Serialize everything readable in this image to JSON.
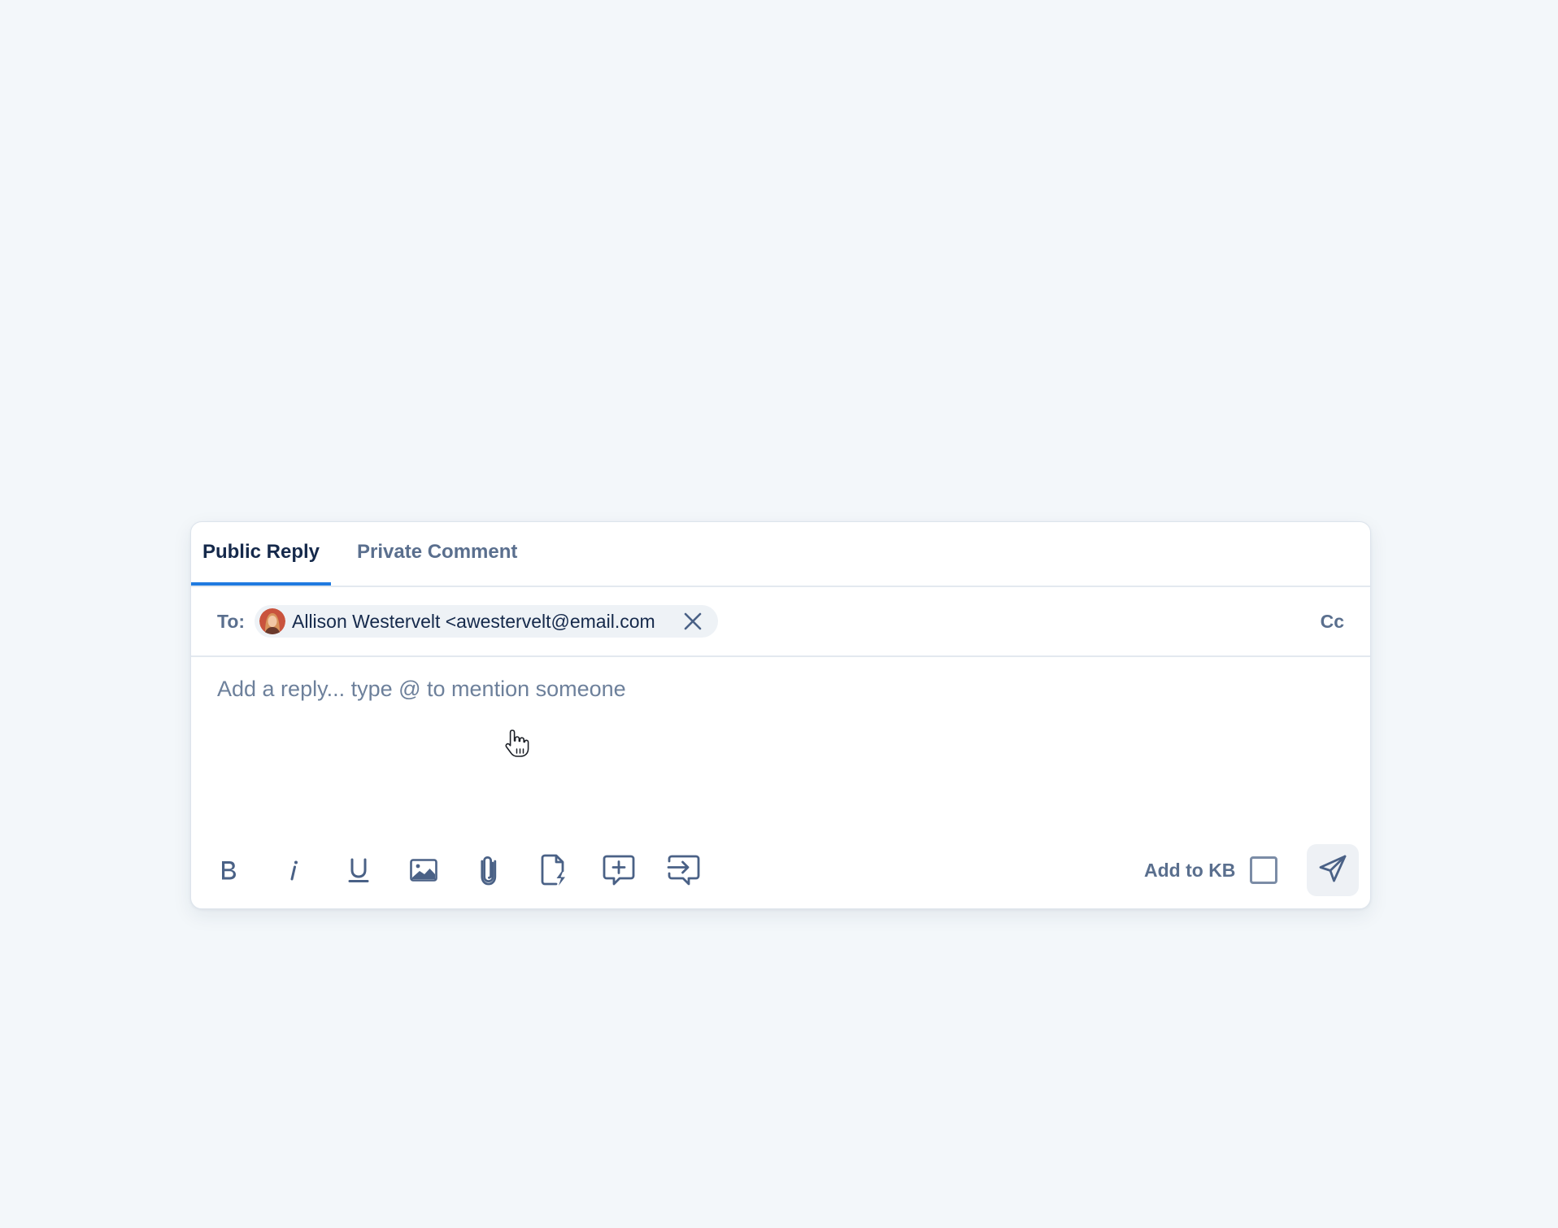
{
  "tabs": [
    {
      "label": "Public Reply",
      "active": true
    },
    {
      "label": "Private Comment",
      "active": false
    }
  ],
  "recipients": {
    "to_label": "To:",
    "chip_text": "Allison Westervelt <awestervelt@email.com",
    "cc_label": "Cc"
  },
  "reply": {
    "placeholder": "Add a reply... type @ to mention someone",
    "value": ""
  },
  "toolbar": {
    "tools": [
      "bold-icon",
      "italic-icon",
      "underline-icon",
      "image-icon",
      "attachment-icon",
      "macro-file-icon",
      "add-comment-icon",
      "forward-icon"
    ],
    "add_to_kb_label": "Add to KB",
    "add_to_kb_checked": false,
    "send_icon": "send-icon"
  },
  "colors": {
    "background": "#f3f7fa",
    "accent": "#1f7ae0",
    "primary_text": "#15294b",
    "muted_text": "#5a6f8e",
    "icon": "#4a6186"
  }
}
